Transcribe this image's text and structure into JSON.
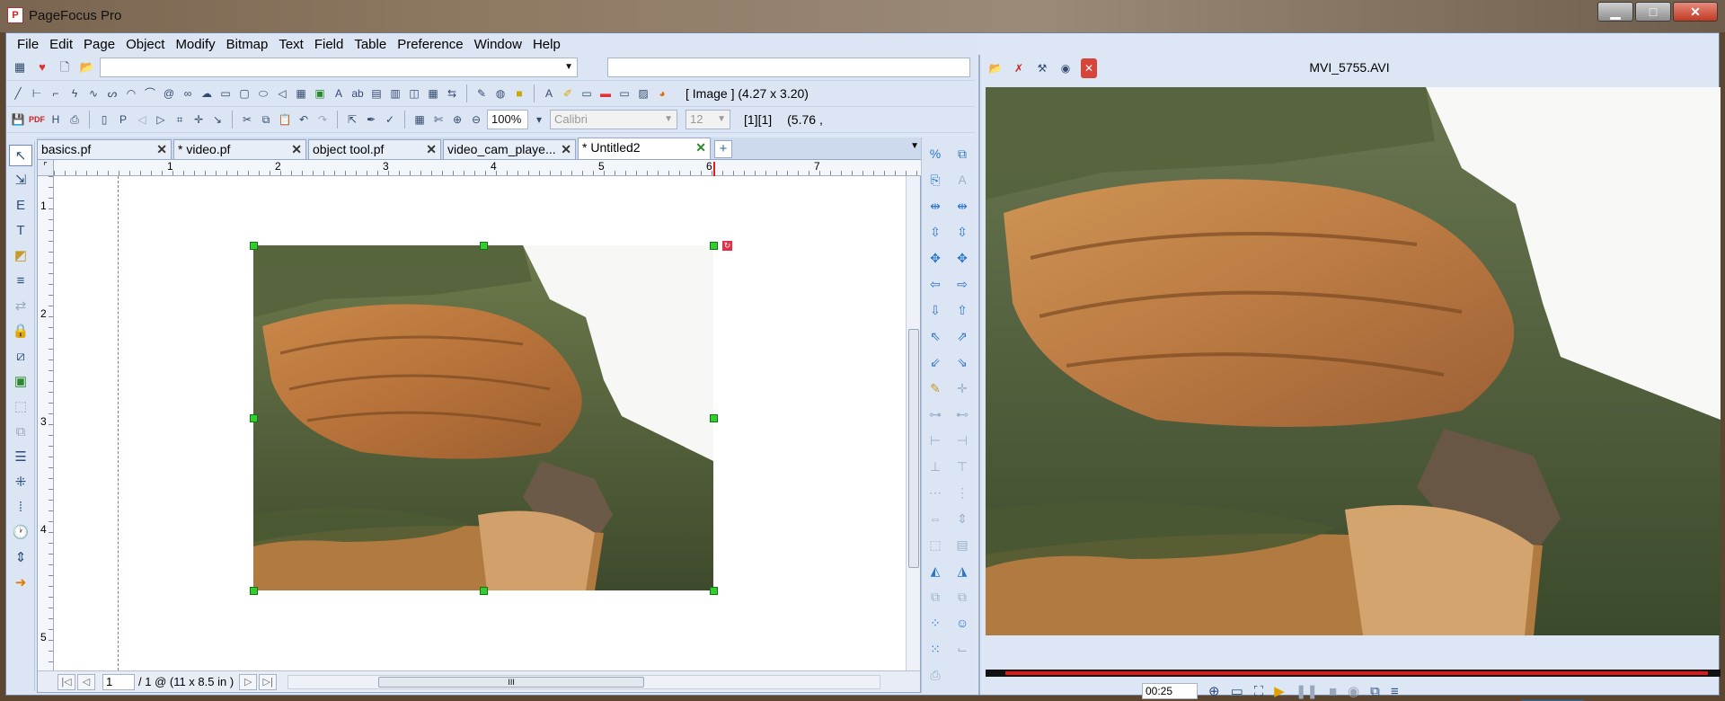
{
  "window": {
    "title": "PageFocus Pro",
    "minimize_glyph": "▁",
    "maximize_glyph": "□",
    "close_glyph": "✕"
  },
  "menu": [
    "File",
    "Edit",
    "Page",
    "Object",
    "Modify",
    "Bitmap",
    "Text",
    "Field",
    "Table",
    "Preference",
    "Window",
    "Help"
  ],
  "toolbar": {
    "zoom": "100%",
    "font": "Calibri",
    "font_size": "12",
    "selection_info": "[ Image ]  (4.27  x  3.20)",
    "cell_ref": "[1][1]",
    "coord": "(5.76 ,"
  },
  "tabs": [
    {
      "label": "basics.pf",
      "active": false
    },
    {
      "label": "* video.pf",
      "active": false
    },
    {
      "label": "object tool.pf",
      "active": false
    },
    {
      "label": "video_cam_playe...",
      "active": false
    },
    {
      "label": "* Untitled2",
      "active": true
    }
  ],
  "ruler": {
    "h": [
      "1",
      "2",
      "3",
      "4",
      "5",
      "6",
      "7"
    ],
    "v": [
      "1",
      "2",
      "3",
      "4",
      "5"
    ]
  },
  "page_nav": {
    "current": "1",
    "info": "/ 1 @ (11 x 8.5 in )",
    "scroll_grip": "III"
  },
  "video": {
    "filename": "MVI_5755.AVI",
    "time": "00:25",
    "progress": 0.99
  },
  "colors": {
    "selection_handle": "#33cc33",
    "progress": "#e01818",
    "accent": "#2f76c8"
  }
}
